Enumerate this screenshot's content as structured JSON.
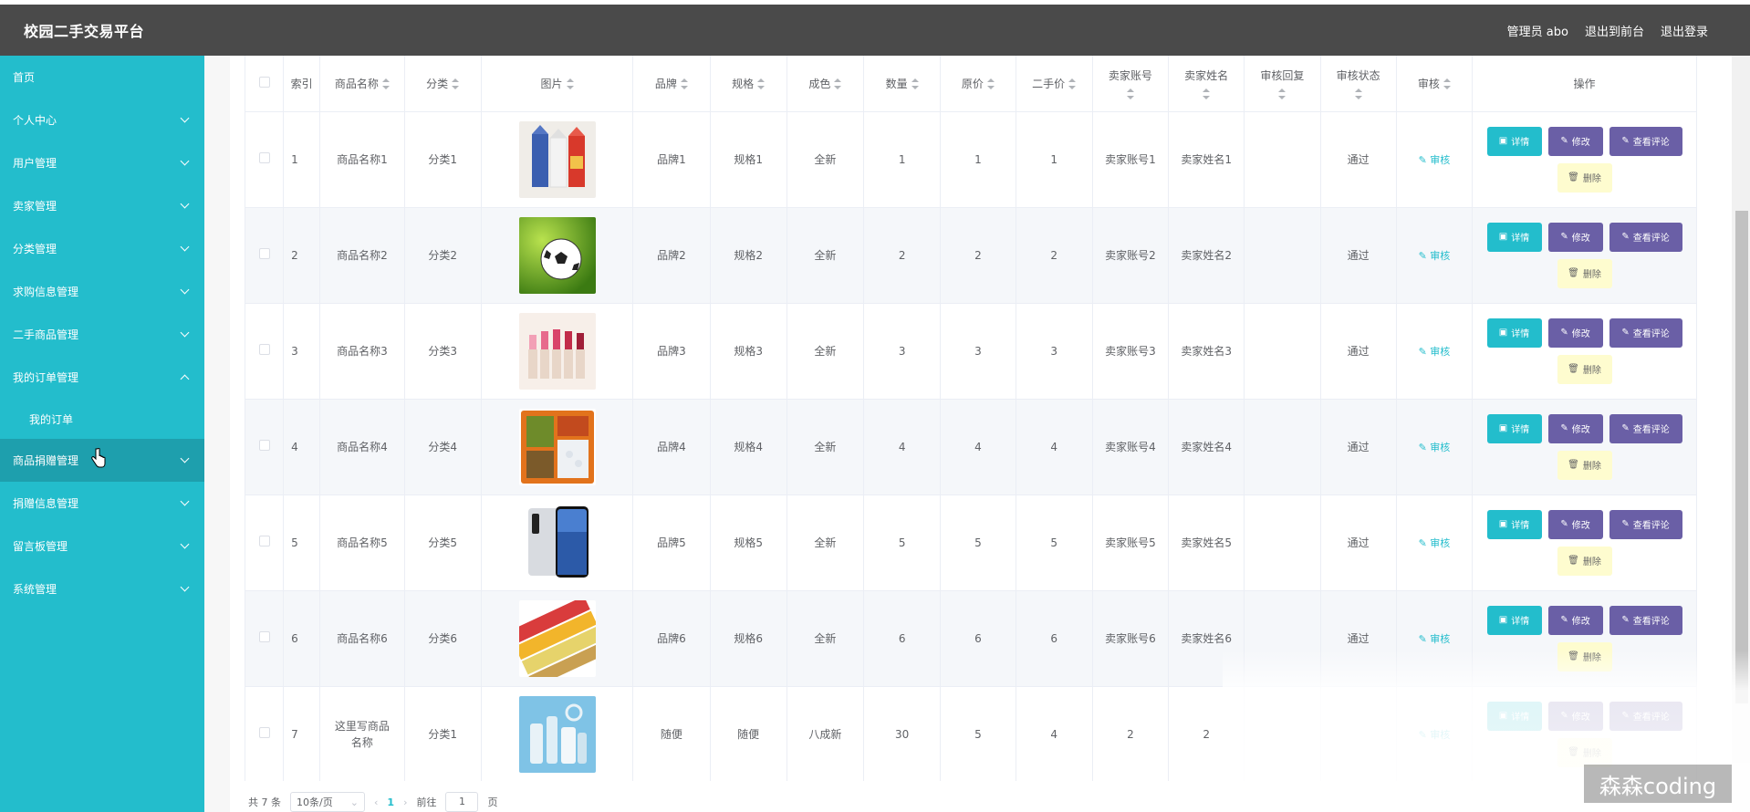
{
  "app": {
    "title": "校园二手交易平台"
  },
  "header": {
    "admin_label": "管理员 abo",
    "front_link": "退出到前台",
    "logout": "退出登录"
  },
  "sidebar": {
    "items": [
      {
        "label": "首页"
      },
      {
        "label": "个人中心"
      },
      {
        "label": "用户管理"
      },
      {
        "label": "卖家管理"
      },
      {
        "label": "分类管理"
      },
      {
        "label": "求购信息管理"
      },
      {
        "label": "二手商品管理"
      },
      {
        "label": "我的订单管理"
      },
      {
        "label": "我的订单"
      },
      {
        "label": "商品捐赠管理"
      },
      {
        "label": "捐赠信息管理"
      },
      {
        "label": "留言板管理"
      },
      {
        "label": "系统管理"
      }
    ]
  },
  "table": {
    "headers": [
      "索引",
      "商品名称",
      "分类",
      "图片",
      "品牌",
      "规格",
      "成色",
      "数量",
      "原价",
      "二手价",
      "卖家账号",
      "卖家姓名",
      "审核回复",
      "审核状态",
      "审核",
      "操作"
    ],
    "rows": [
      {
        "idx": "1",
        "name": "商品名称1",
        "cat": "分类1",
        "brand": "品牌1",
        "spec": "规格1",
        "cond": "全新",
        "qty": "1",
        "orig": "1",
        "price": "1",
        "acct": "卖家账号1",
        "seller": "卖家姓名1",
        "reply": "",
        "status": "通过",
        "image": "milk-cartons"
      },
      {
        "idx": "2",
        "name": "商品名称2",
        "cat": "分类2",
        "brand": "品牌2",
        "spec": "规格2",
        "cond": "全新",
        "qty": "2",
        "orig": "2",
        "price": "2",
        "acct": "卖家账号2",
        "seller": "卖家姓名2",
        "reply": "",
        "status": "通过",
        "image": "soccer-ball"
      },
      {
        "idx": "3",
        "name": "商品名称3",
        "cat": "分类3",
        "brand": "品牌3",
        "spec": "规格3",
        "cond": "全新",
        "qty": "3",
        "orig": "3",
        "price": "3",
        "acct": "卖家账号3",
        "seller": "卖家姓名3",
        "reply": "",
        "status": "通过",
        "image": "lipsticks"
      },
      {
        "idx": "4",
        "name": "商品名称4",
        "cat": "分类4",
        "brand": "品牌4",
        "spec": "规格4",
        "cond": "全新",
        "qty": "4",
        "orig": "4",
        "price": "4",
        "acct": "卖家账号4",
        "seller": "卖家姓名4",
        "reply": "",
        "status": "通过",
        "image": "lunch-box"
      },
      {
        "idx": "5",
        "name": "商品名称5",
        "cat": "分类5",
        "brand": "品牌5",
        "spec": "规格5",
        "cond": "全新",
        "qty": "5",
        "orig": "5",
        "price": "5",
        "acct": "卖家账号5",
        "seller": "卖家姓名5",
        "reply": "",
        "status": "通过",
        "image": "smartphone"
      },
      {
        "idx": "6",
        "name": "商品名称6",
        "cat": "分类6",
        "brand": "品牌6",
        "spec": "规格6",
        "cond": "全新",
        "qty": "6",
        "orig": "6",
        "price": "6",
        "acct": "卖家账号6",
        "seller": "卖家姓名6",
        "reply": "",
        "status": "通过",
        "image": "snack-bags"
      },
      {
        "idx": "7",
        "name": "这里写商品名称",
        "cat": "分类1",
        "brand": "随便",
        "spec": "随便",
        "cond": "八成新",
        "qty": "30",
        "orig": "5",
        "price": "4",
        "acct": "2",
        "seller": "2",
        "reply": "",
        "status": "",
        "image": "bottles"
      }
    ],
    "audit_label": "审核",
    "actions": {
      "detail": "详情",
      "edit": "修改",
      "review": "查看评论",
      "delete": "删除"
    }
  },
  "pagination": {
    "total": "共 7 条",
    "page_size": "10条/页",
    "current": "1",
    "goto": "前往",
    "goto_value": "1",
    "page_unit": "页"
  },
  "watermark": "森森coding",
  "colors": {
    "sidebar": "#23bdcc",
    "topbar": "#4a4a4a",
    "accent": "#23bdcc",
    "purple": "#6a5fa6",
    "delete_bg": "#fefccf"
  }
}
